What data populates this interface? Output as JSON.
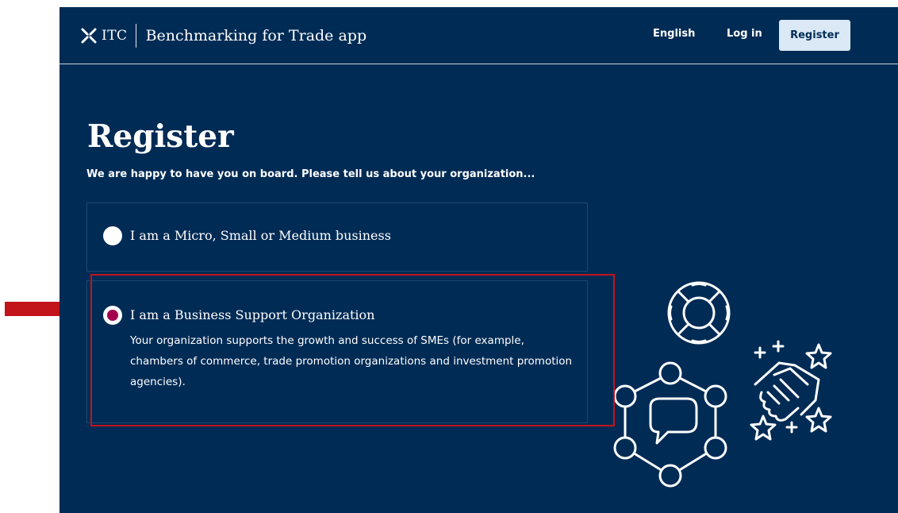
{
  "header": {
    "logo_text": "ITC",
    "app_title": "Benchmarking for Trade app",
    "nav": {
      "language": "English",
      "login": "Log in",
      "register": "Register"
    }
  },
  "main": {
    "title": "Register",
    "subtitle": "We are happy to have you on board. Please tell us about your organization...",
    "options": [
      {
        "label": "I am a Micro, Small or Medium business",
        "selected": false
      },
      {
        "label": "I am a Business Support Organization",
        "description": "Your organization supports the growth and success of SMEs (for example, chambers of commerce, trade promotion organizations and investment promotion agencies).",
        "selected": true
      }
    ]
  },
  "colors": {
    "background": "#002b55",
    "register_button": "#dbe8f6",
    "radio_selected": "#a5004f",
    "annotation": "#c2141b"
  },
  "icons": [
    "itc-logo-icon",
    "lifebuoy-icon",
    "network-chat-icon",
    "handshake-stars-icon",
    "arrow-annotation-icon"
  ]
}
